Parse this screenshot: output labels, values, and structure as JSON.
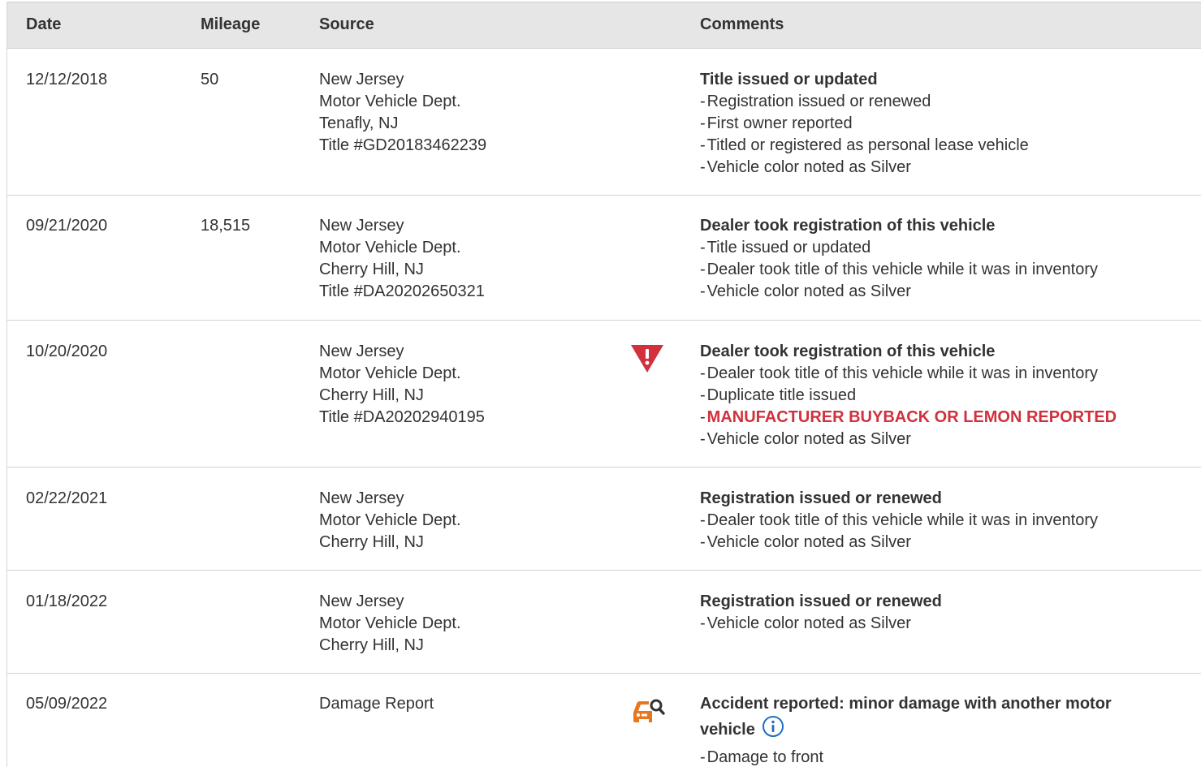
{
  "headers": {
    "date": "Date",
    "mileage": "Mileage",
    "source": "Source",
    "comments": "Comments"
  },
  "colors": {
    "alert_red": "#d0313d",
    "damage_orange": "#e8761d",
    "info_blue": "#1a6fc4",
    "header_bg": "#e6e6e6"
  },
  "records": [
    {
      "date": "12/12/2018",
      "mileage": "50",
      "source": [
        "New Jersey",
        "Motor Vehicle Dept.",
        "Tenafly, NJ",
        "Title #GD20183462239"
      ],
      "icon": "",
      "comment_title": "Title issued or updated",
      "comment_lines": [
        {
          "dash": "-",
          "text": "Registration issued or renewed"
        },
        {
          "dash": "-",
          "text": "First owner reported"
        },
        {
          "dash": "-",
          "text": "Titled or registered as personal lease vehicle"
        },
        {
          "dash": "-",
          "text": "Vehicle color noted as Silver"
        }
      ]
    },
    {
      "date": "09/21/2020",
      "mileage": "18,515",
      "source": [
        "New Jersey",
        "Motor Vehicle Dept.",
        "Cherry Hill, NJ",
        "Title #DA20202650321"
      ],
      "icon": "",
      "comment_title": "Dealer took registration of this vehicle",
      "comment_lines": [
        {
          "dash": "-",
          "text": "Title issued or updated"
        },
        {
          "dash": "-",
          "text": "Dealer took title of this vehicle while it was in inventory"
        },
        {
          "dash": "-",
          "text": "Vehicle color noted as Silver"
        }
      ]
    },
    {
      "date": "10/20/2020",
      "mileage": "",
      "source": [
        "New Jersey",
        "Motor Vehicle Dept.",
        "Cherry Hill, NJ",
        "Title #DA20202940195"
      ],
      "icon": "warning-triangle-icon",
      "comment_title": "Dealer took registration of this vehicle",
      "comment_lines": [
        {
          "dash": "-",
          "text": "Dealer took title of this vehicle while it was in inventory"
        },
        {
          "dash": "-",
          "text": "Duplicate title issued"
        },
        {
          "dash": "-",
          "text": "MANUFACTURER BUYBACK OR LEMON REPORTED",
          "alert": true
        },
        {
          "dash": "-",
          "text": "Vehicle color noted as Silver"
        }
      ]
    },
    {
      "date": "02/22/2021",
      "mileage": "",
      "source": [
        "New Jersey",
        "Motor Vehicle Dept.",
        "Cherry Hill, NJ"
      ],
      "icon": "",
      "comment_title": "Registration issued or renewed",
      "comment_lines": [
        {
          "dash": "-",
          "text": "Dealer took title of this vehicle while it was in inventory"
        },
        {
          "dash": "-",
          "text": "Vehicle color noted as Silver"
        }
      ]
    },
    {
      "date": "01/18/2022",
      "mileage": "",
      "source": [
        "New Jersey",
        "Motor Vehicle Dept.",
        "Cherry Hill, NJ"
      ],
      "icon": "",
      "comment_title": "Registration issued or renewed",
      "comment_lines": [
        {
          "dash": "-",
          "text": "Vehicle color noted as Silver"
        }
      ]
    },
    {
      "date": "05/09/2022",
      "mileage": "",
      "source": [
        "Damage Report"
      ],
      "icon": "damage-car-search-icon",
      "comment_title": "Accident reported: minor damage with another motor vehicle",
      "info_icon": "info-circle-icon",
      "comment_lines": [
        {
          "dash": "-",
          "text": "Damage to front"
        }
      ]
    }
  ]
}
